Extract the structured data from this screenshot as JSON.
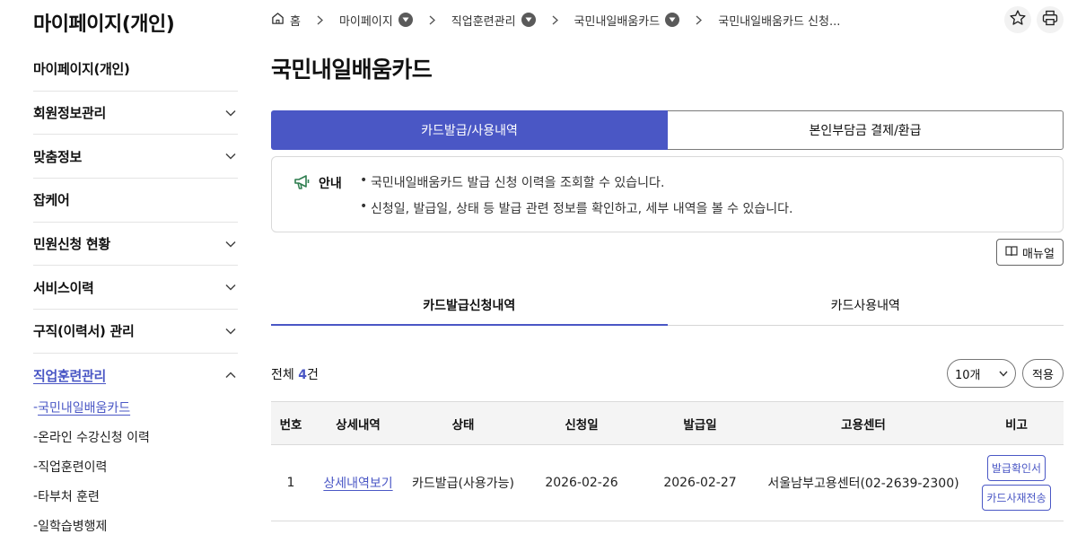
{
  "sidebar": {
    "title": "마이페이지(개인)",
    "items": [
      {
        "label": "마이페이지(개인)",
        "chevron": ""
      },
      {
        "label": "회원정보관리",
        "chevron": "down"
      },
      {
        "label": "맞춤정보",
        "chevron": "down"
      },
      {
        "label": "잡케어",
        "chevron": ""
      },
      {
        "label": "민원신청 현황",
        "chevron": "down"
      },
      {
        "label": "서비스이력",
        "chevron": "down"
      },
      {
        "label": "구직(이력서) 관리",
        "chevron": "down"
      },
      {
        "label": "직업훈련관리",
        "chevron": "up"
      }
    ],
    "sub_items": [
      {
        "label": "국민내일배움카드"
      },
      {
        "label": "온라인 수강신청 이력"
      },
      {
        "label": "직업훈련이력"
      },
      {
        "label": "타부처 훈련"
      },
      {
        "label": "일학습병행제"
      }
    ],
    "sub_prefix": "-"
  },
  "breadcrumb": {
    "home": "홈",
    "items": [
      "마이페이지",
      "직업훈련관리",
      "국민내일배움카드",
      "국민내일배움카드 신청..."
    ]
  },
  "page_title": "국민내일배움카드",
  "top_tabs": [
    "카드발급/사용내역",
    "본인부담금 결제/환급"
  ],
  "notice": {
    "label": "안내",
    "lines": [
      "국민내일배움카드 발급 신청 이력을 조회할 수 있습니다.",
      "신청일, 발급일, 상태 등 발급 관련 정보를 확인하고, 세부 내역을 볼 수 있습니다."
    ]
  },
  "manual_button": "매뉴얼",
  "sub_tabs": [
    "카드발급신청내역",
    "카드사용내역"
  ],
  "count": {
    "prefix": "전체 ",
    "number": "4",
    "suffix": "건"
  },
  "page_size": "10개",
  "apply_button": "적용",
  "table": {
    "headers": [
      "번호",
      "상세내역",
      "상태",
      "신청일",
      "발급일",
      "고용센터",
      "비고"
    ],
    "rows": [
      {
        "no": "1",
        "detail": "상세내역보기",
        "status": "카드발급(사용가능)",
        "applied": "2026-02-26",
        "issued": "2026-02-27",
        "center": "서울남부고용센터(02-2639-2300)",
        "btn1": "발급확인서",
        "btn2": "카드사재전송"
      }
    ]
  },
  "colors": {
    "accent": "#4a57c5"
  }
}
